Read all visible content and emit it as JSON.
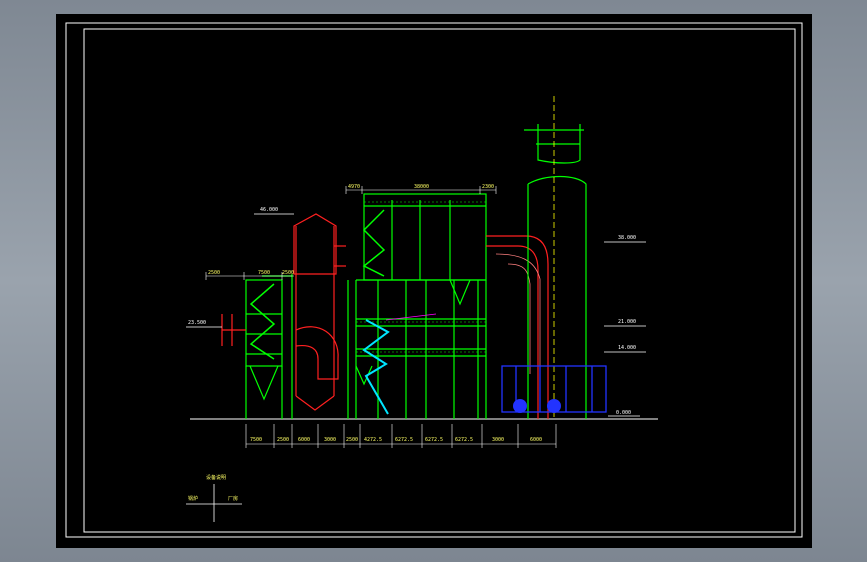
{
  "drawing": {
    "elevations": {
      "top_left": "46.000",
      "left_mid": "23.500",
      "right_top": "38.000",
      "right_mid": "21.000",
      "right_low": "14.000",
      "ground": "0.000"
    },
    "top_dims": [
      "4970",
      "38000",
      "2300"
    ],
    "left_top_dims": [
      "2500",
      "7500",
      "2500"
    ],
    "bottom_dims": [
      "7500",
      "2500",
      "6000",
      "3000",
      "2500",
      "4272.5",
      "6272.5",
      "6272.5",
      "6272.5",
      "3000",
      "6000"
    ],
    "legend": {
      "title": "设备说明",
      "left_label": "锅炉",
      "right_label": "厂房"
    }
  },
  "colors": {
    "background": "#000000",
    "frame": "#ffffff",
    "structure": "#00ff00",
    "duct": "#ff2020",
    "ladder": "#00e5ff",
    "chimney": "#00ff00",
    "fan": "#2233ff",
    "centerline": "#ffff00",
    "dimension": "#ffff66",
    "piping": "#ff00ff"
  }
}
